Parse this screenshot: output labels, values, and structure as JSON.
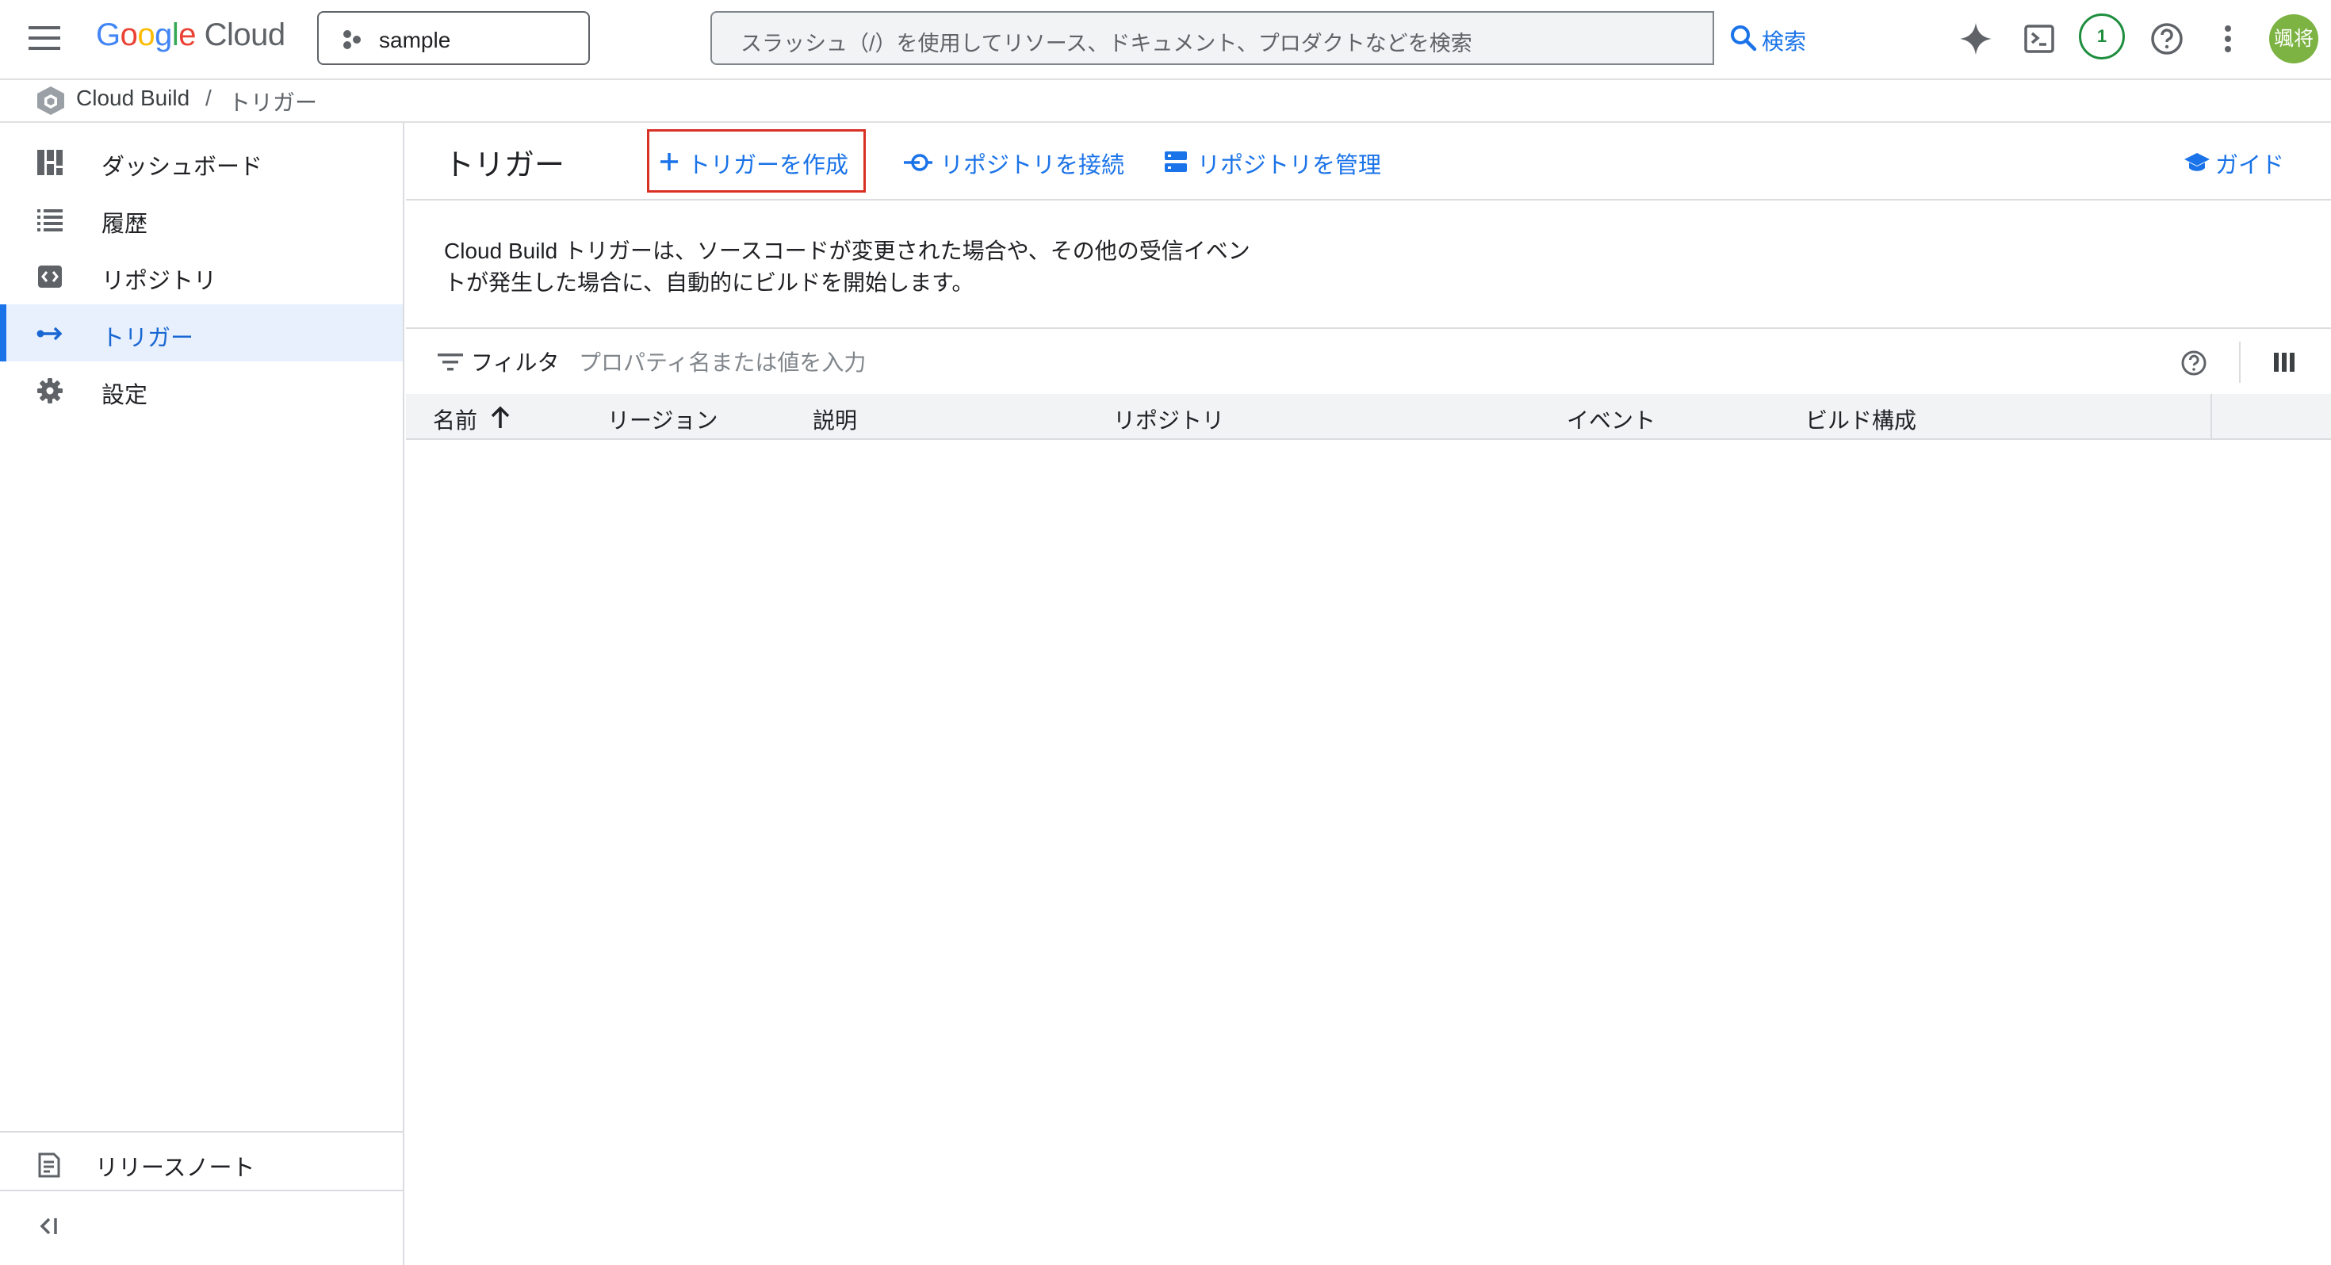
{
  "header": {
    "logo_text": "Google Cloud",
    "project_name": "sample",
    "search_placeholder": "スラッシュ（/）を使用してリソース、ドキュメント、プロダクトなどを検索",
    "search_button": "検索",
    "notification_count": "1",
    "avatar_text": "颯将"
  },
  "breadcrumb": {
    "product": "Cloud Build",
    "separator": "/",
    "page": "トリガー"
  },
  "sidebar": {
    "items": [
      {
        "label": "ダッシュボード",
        "icon": "dashboard-icon"
      },
      {
        "label": "履歴",
        "icon": "list-icon"
      },
      {
        "label": "リポジトリ",
        "icon": "repository-icon"
      },
      {
        "label": "トリガー",
        "icon": "trigger-icon",
        "active": true
      },
      {
        "label": "設定",
        "icon": "gear-icon"
      }
    ],
    "release_notes": "リリースノート",
    "collapse_icon": "collapse-icon"
  },
  "main": {
    "title": "トリガー",
    "actions": {
      "create": "トリガーを作成",
      "connect": "リポジトリを接続",
      "manage": "リポジトリを管理",
      "guide": "ガイド"
    },
    "description_line1": "Cloud Build トリガーは、ソースコードが変更された場合や、その他の受信イベン",
    "description_line2": "トが発生した場合に、自動的にビルドを開始します。",
    "filter": {
      "label": "フィルタ",
      "placeholder": "プロパティ名または値を入力"
    },
    "table": {
      "columns": [
        "名前",
        "リージョン",
        "説明",
        "リポジトリ",
        "イベント",
        "ビルド構成"
      ],
      "sort_column": "名前",
      "sort_direction": "ascending",
      "rows": []
    }
  },
  "colors": {
    "accent": "#1a73e8",
    "active_bg": "#e8f0fe",
    "highlight_box": "#d93025",
    "badge": "#1e8e3e",
    "avatar": "#7cb342"
  }
}
